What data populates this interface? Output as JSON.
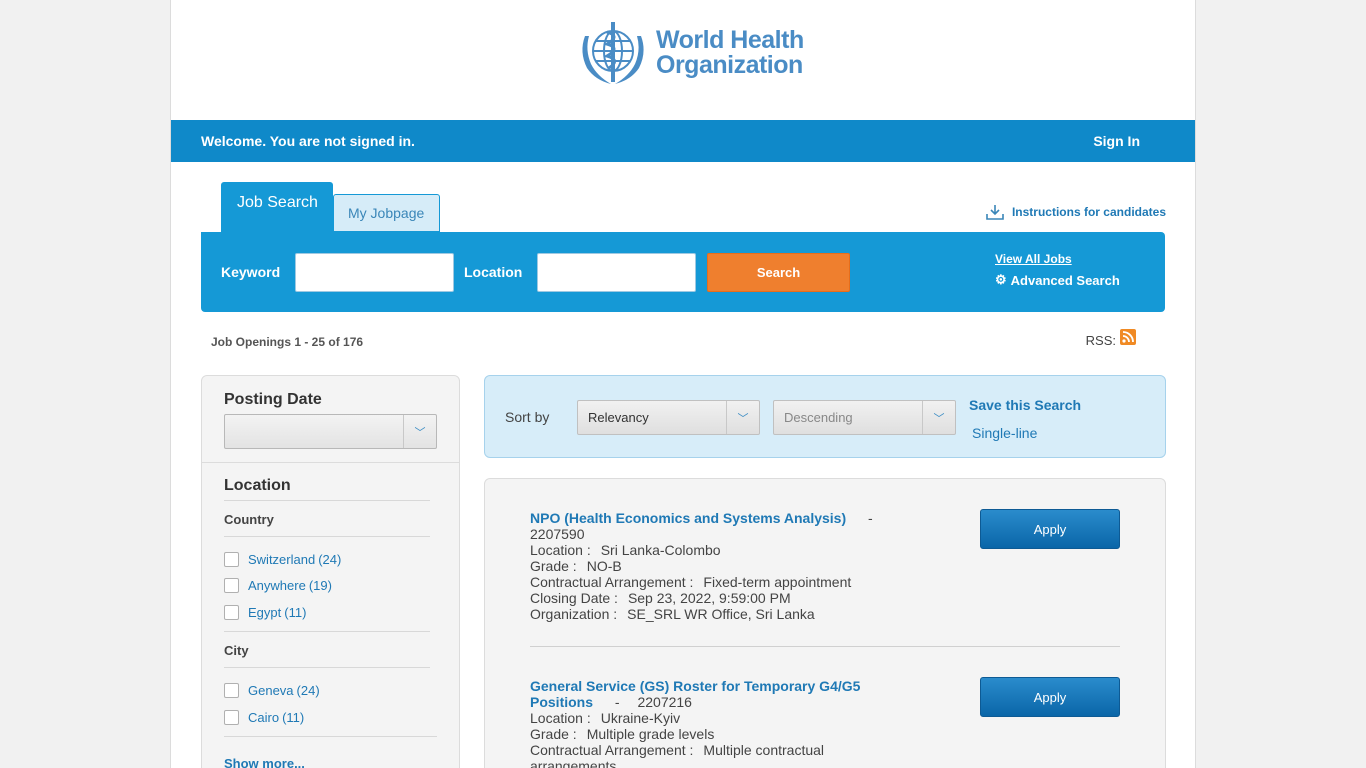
{
  "brand": {
    "name_line1": "World Health",
    "name_line2": "Organization",
    "color": "#4a8cc5"
  },
  "welcome_bar": {
    "message": "Welcome. You are not signed in.",
    "sign_in": "Sign In",
    "color": "#0f89c9"
  },
  "tabs": [
    {
      "label": "Job Search",
      "active": true
    },
    {
      "label": "My Jobpage",
      "active": false
    }
  ],
  "instructions_link": {
    "label": "Instructions for candidates",
    "icon": "download-icon"
  },
  "search": {
    "keyword_label": "Keyword",
    "keyword_value": "",
    "location_label": "Location",
    "location_value": "",
    "search_button": "Search",
    "view_all_jobs": "View All Jobs",
    "advanced_search": "Advanced Search",
    "panel_color": "#1599d6",
    "button_color": "#ef7f2e"
  },
  "summary": {
    "job_openings": "Job Openings 1 - 25 of 176",
    "rss_label": "RSS:"
  },
  "filters": {
    "posting_date_heading": "Posting Date",
    "posting_date_value": "",
    "location_heading": "Location",
    "country_heading": "Country",
    "countries": [
      {
        "name": "Switzerland",
        "count": "(24)"
      },
      {
        "name": "Anywhere",
        "count": "(19)"
      },
      {
        "name": "Egypt",
        "count": "(11)"
      }
    ],
    "city_heading": "City",
    "cities": [
      {
        "name": "Geneva",
        "count": "(24)"
      },
      {
        "name": "Cairo",
        "count": "(11)"
      }
    ],
    "show_more": "Show more..."
  },
  "sort": {
    "label": "Sort by",
    "field": "Relevancy",
    "order": "Descending",
    "save_search": "Save this Search",
    "single_line": "Single-line"
  },
  "jobs": [
    {
      "title": "NPO (Health Economics and Systems Analysis)",
      "dash": "-",
      "number": "2207590",
      "location_label": "Location :",
      "location": "Sri Lanka-Colombo",
      "grade_label": "Grade :",
      "grade": "NO-B",
      "contract_label": "Contractual Arrangement :",
      "contract": "Fixed-term appointment",
      "closing_label": "Closing Date :",
      "closing": "Sep 23, 2022, 9:59:00 PM",
      "org_label": "Organization :",
      "org": "SE_SRL WR Office, Sri Lanka",
      "apply": "Apply"
    },
    {
      "title_line1": "General Service (GS) Roster for Temporary G4/G5",
      "title_line2": "Positions",
      "dash": "-",
      "number": "2207216",
      "location_label": "Location :",
      "location": "Ukraine-Kyiv",
      "grade_label": "Grade :",
      "grade": "Multiple grade levels",
      "contract_label": "Contractual Arrangement :",
      "contract_line1": "Multiple contractual",
      "contract_line2": "arrangements",
      "apply": "Apply"
    }
  ]
}
